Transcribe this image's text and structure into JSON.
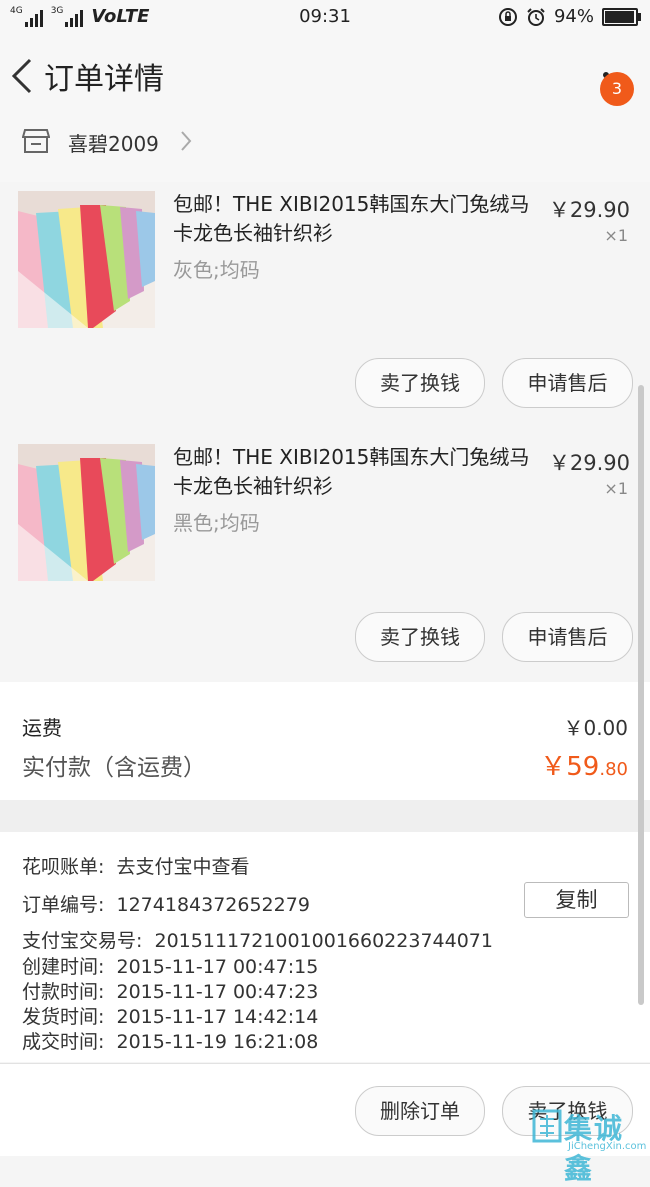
{
  "status_bar": {
    "net1": "4G",
    "net2": "3G",
    "volte": "VoLTE",
    "time": "09:31",
    "battery": "94%"
  },
  "nav": {
    "title": "订单详情",
    "badge_count": "3"
  },
  "shop": {
    "name": "喜碧2009"
  },
  "items": [
    {
      "title": "包邮！THE XIBI2015韩国东大门兔绒马卡龙色长袖针织衫",
      "sku": "灰色;均码",
      "price": "￥29.90",
      "qty": "×1",
      "btn_sell": "卖了换钱",
      "btn_after": "申请售后"
    },
    {
      "title": "包邮！THE XIBI2015韩国东大门兔绒马卡龙色长袖针织衫",
      "sku": "黑色;均码",
      "price": "￥29.90",
      "qty": "×1",
      "btn_sell": "卖了换钱",
      "btn_after": "申请售后"
    }
  ],
  "summary": {
    "shipping_label": "运费",
    "shipping_value": "￥0.00",
    "paid_label": "实付款（含运费）",
    "paid_int": "￥59",
    "paid_dec": ".80"
  },
  "info": {
    "huabei_label": "花呗账单:",
    "huabei_value": "去支付宝中查看",
    "order_no_label": "订单编号:",
    "order_no_value": "1274184372652279",
    "copy_label": "复制",
    "alipay_label": "支付宝交易号:",
    "alipay_value": "2015111721001001660223744071",
    "created_label": "创建时间:",
    "created_value": "2015-11-17 00:47:15",
    "paid_time_label": "付款时间:",
    "paid_time_value": "2015-11-17 00:47:23",
    "shipped_label": "发货时间:",
    "shipped_value": "2015-11-17 14:42:14",
    "done_label": "成交时间:",
    "done_value": "2015-11-19 16:21:08"
  },
  "bottom": {
    "delete_label": "删除订单",
    "sell_label": "卖了换钱"
  },
  "watermark": {
    "text": "集诚鑫",
    "sub": "JiChengXin.com"
  },
  "colors": {
    "accent": "#f05a1a"
  }
}
